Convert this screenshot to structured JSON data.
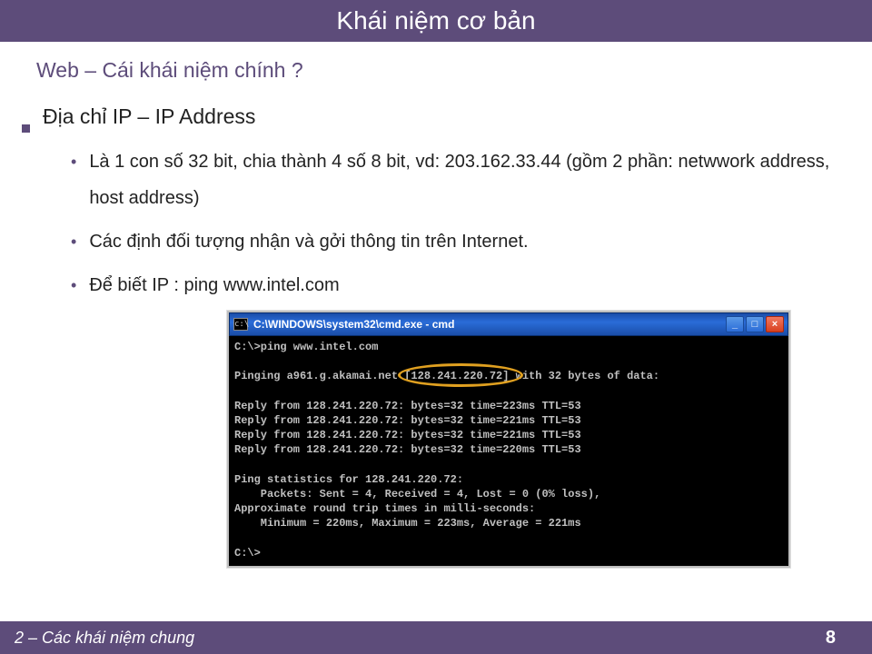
{
  "title": "Khái niệm cơ bản",
  "subtitle": "Web – Cái khái niệm chính ?",
  "heading": "Địa chỉ IP – IP Address",
  "bullets": [
    "Là 1 con số 32 bit, chia thành 4 số 8 bit, vd: 203.162.33.44 (gồm 2 phần: netwwork address, host address)",
    "Các định đối tượng nhận và gởi thông tin trên Internet.",
    "Để biết IP : ping www.intel.com"
  ],
  "cmd": {
    "title": "C:\\WINDOWS\\system32\\cmd.exe - cmd",
    "lines": "C:\\>ping www.intel.com\n\nPinging a961.g.akamai.net [128.241.220.72] with 32 bytes of data:\n\nReply from 128.241.220.72: bytes=32 time=223ms TTL=53\nReply from 128.241.220.72: bytes=32 time=221ms TTL=53\nReply from 128.241.220.72: bytes=32 time=221ms TTL=53\nReply from 128.241.220.72: bytes=32 time=220ms TTL=53\n\nPing statistics for 128.241.220.72:\n    Packets: Sent = 4, Received = 4, Lost = 0 (0% loss),\nApproximate round trip times in milli-seconds:\n    Minimum = 220ms, Maximum = 223ms, Average = 221ms\n\nC:\\>",
    "highlighted_ip": "[128.241.220.72]"
  },
  "footer": {
    "left": "2 – Các khái niệm chung",
    "page": "8"
  }
}
